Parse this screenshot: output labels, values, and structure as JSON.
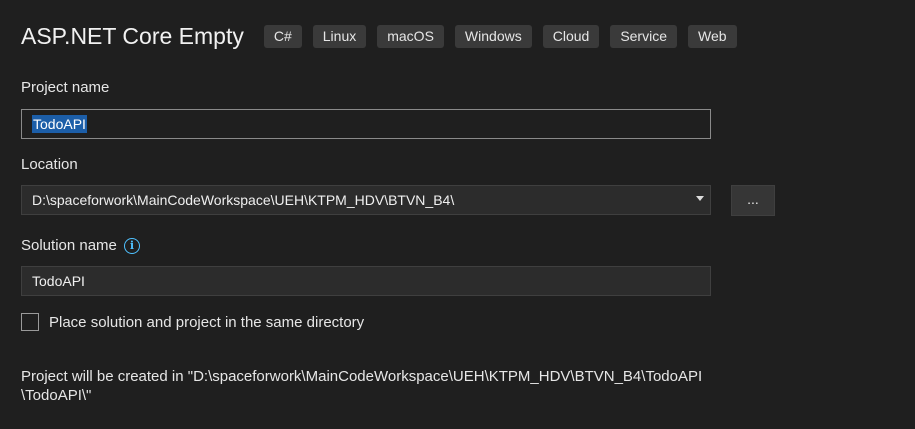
{
  "header": {
    "title": "ASP.NET Core Empty",
    "tags": [
      "C#",
      "Linux",
      "macOS",
      "Windows",
      "Cloud",
      "Service",
      "Web"
    ]
  },
  "project_name": {
    "label": "Project name",
    "value": "TodoAPI"
  },
  "location": {
    "label": "Location",
    "value": "D:\\spaceforwork\\MainCodeWorkspace\\UEH\\KTPM_HDV\\BTVN_B4\\",
    "browse_label": "..."
  },
  "solution_name": {
    "label": "Solution name",
    "value": "TodoAPI"
  },
  "same_directory": {
    "label": "Place solution and project in the same directory",
    "checked": false
  },
  "summary": {
    "line1": "Project will be created in \"D:\\spaceforwork\\MainCodeWorkspace\\UEH\\KTPM_HDV\\BTVN_B4\\TodoAPI",
    "line2": "\\TodoAPI\\\""
  },
  "icons": {
    "info": "info-icon",
    "dropdown": "chevron-down-icon"
  },
  "colors": {
    "background": "#1f1f1f",
    "selection": "#1c5ea8",
    "info": "#4fc1ff"
  }
}
